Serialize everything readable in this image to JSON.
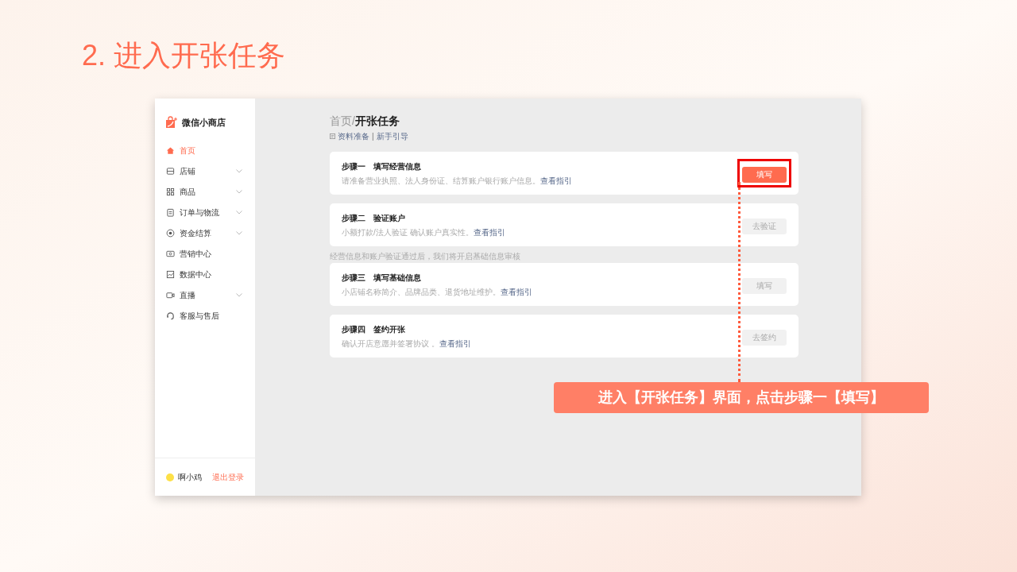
{
  "slide_title": "2. 进入开张任务",
  "app": {
    "name": "微信小商店",
    "nav": [
      {
        "label": "首页",
        "selected": true,
        "expandable": false
      },
      {
        "label": "店铺",
        "selected": false,
        "expandable": true
      },
      {
        "label": "商品",
        "selected": false,
        "expandable": true
      },
      {
        "label": "订单与物流",
        "selected": false,
        "expandable": true
      },
      {
        "label": "资金结算",
        "selected": false,
        "expandable": true
      },
      {
        "label": "营销中心",
        "selected": false,
        "expandable": false
      },
      {
        "label": "数据中心",
        "selected": false,
        "expandable": false
      },
      {
        "label": "直播",
        "selected": false,
        "expandable": true
      },
      {
        "label": "客服与售后",
        "selected": false,
        "expandable": false
      }
    ],
    "user": {
      "name": "啊小鸡",
      "logout": "退出登录"
    }
  },
  "breadcrumb": {
    "items": [
      "首页",
      "开张任务"
    ],
    "separator": "/"
  },
  "guide_links": {
    "items": [
      "资料准备",
      "新手引导"
    ],
    "separator": "|"
  },
  "steps": [
    {
      "step": "步骤一",
      "title": "填写经营信息",
      "desc": "请准备营业执照、法人身份证、结算账户银行账户信息。",
      "link": "查看指引",
      "button": "填写",
      "disabled": false,
      "highlighted": true
    },
    {
      "step": "步骤二",
      "title": "验证账户",
      "desc": "小额打款/法人验证 确认账户真实性。",
      "link": "查看指引",
      "button": "去验证",
      "disabled": true,
      "highlighted": false
    },
    {
      "note": "经营信息和账户验证通过后，我们将开启基础信息审核",
      "step": "步骤三",
      "title": "填写基础信息",
      "desc": "小店铺名称简介、品牌品类、退货地址维护。",
      "link": "查看指引",
      "button": "填写",
      "disabled": true,
      "highlighted": false
    },
    {
      "step": "步骤四",
      "title": "签约开张",
      "desc": "确认开店意愿并签署协议 。",
      "link": "查看指引",
      "button": "去签约",
      "disabled": true,
      "highlighted": false
    }
  ],
  "callout": "进入【开张任务】界面，点击步骤一【填写】"
}
